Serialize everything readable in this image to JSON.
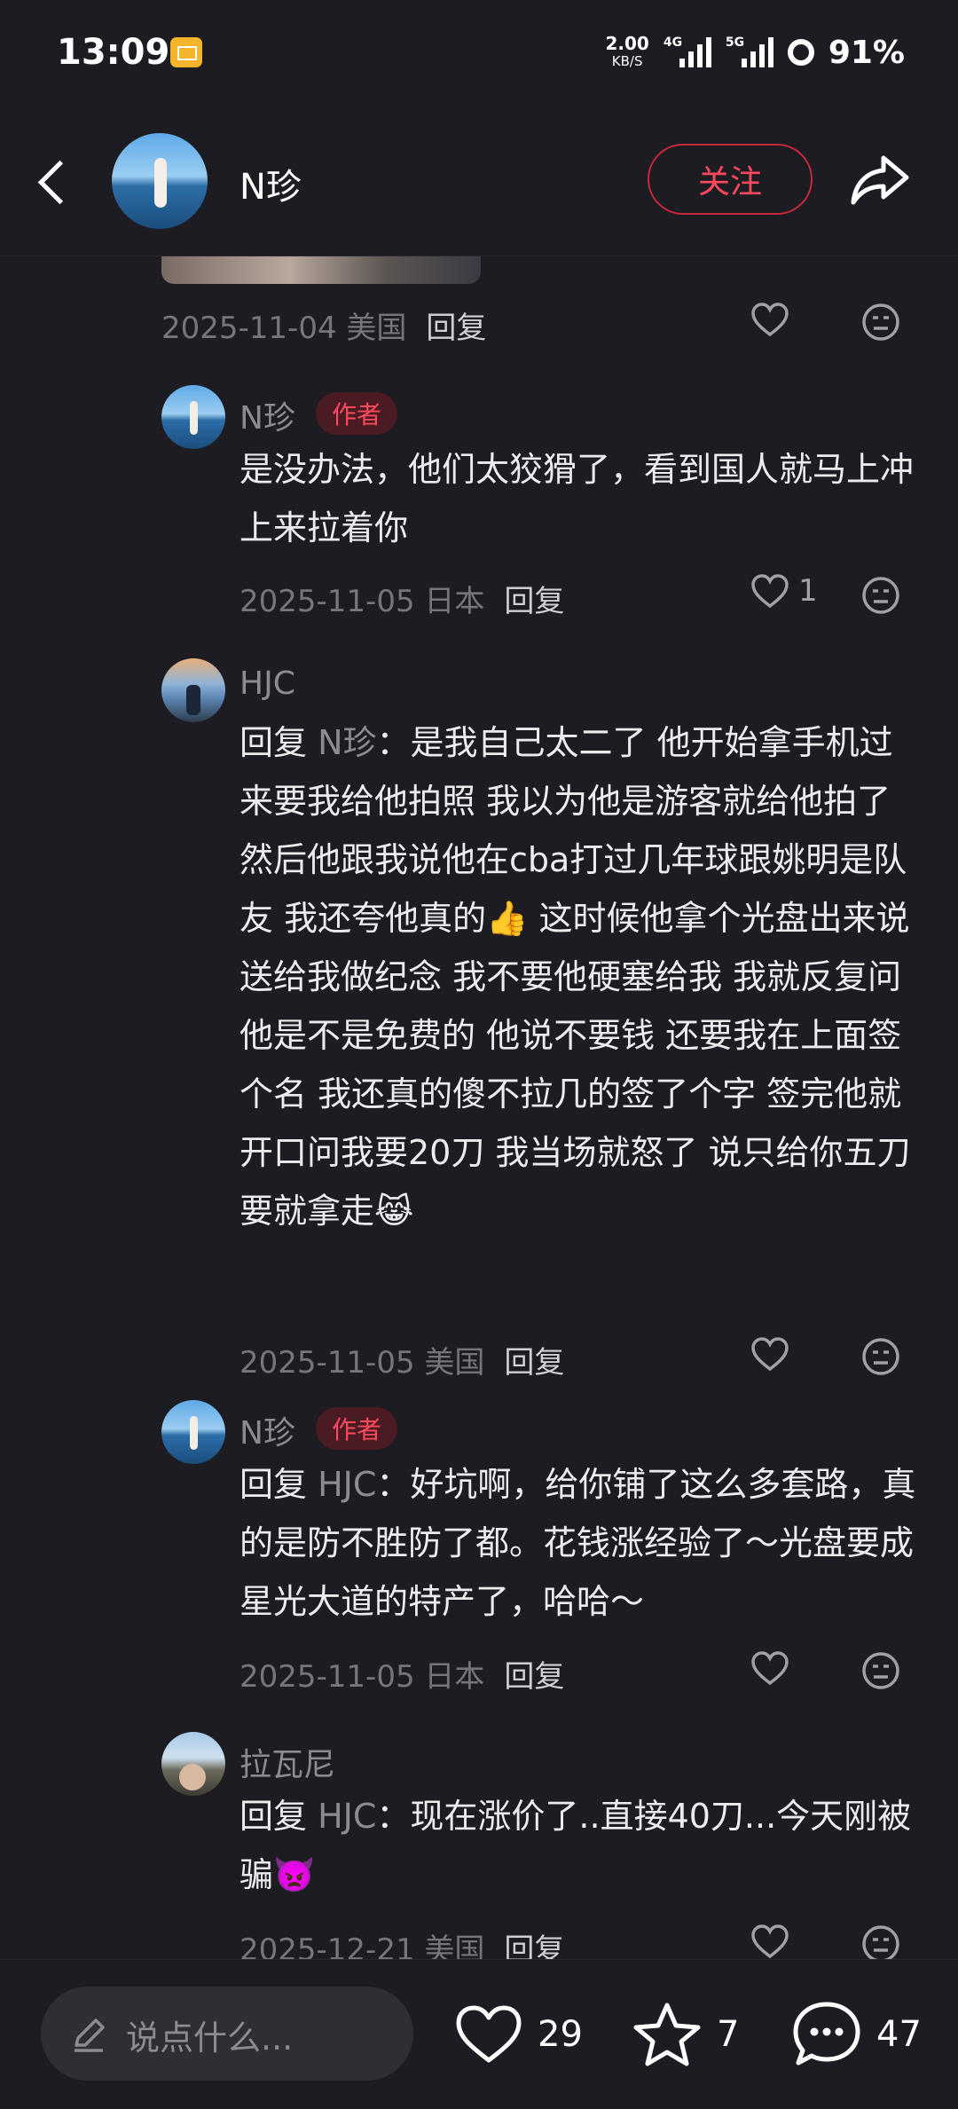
{
  "status_bar": {
    "time": "13:09",
    "net_speed": "2.00",
    "net_unit": "KB/S",
    "sig1_label": "4G",
    "sig2_label": "5G",
    "battery": "91%"
  },
  "header": {
    "name": "N珍",
    "follow_label": "关注"
  },
  "comments": [
    {
      "meta_date": "2025-11-04 美国",
      "reply_label": "回复",
      "like_count": ""
    },
    {
      "name": "N珍",
      "author_tag": "作者",
      "text": "是没办法，他们太狡猾了，看到国人就马上冲上来拉着你",
      "meta_date": "2025-11-05 日本",
      "reply_label": "回复",
      "like_count": "1"
    },
    {
      "name": "HJC",
      "reply_prefix": "回复 ",
      "reply_target": "N珍",
      "text": "：是我自己太二了 他开始拿手机过来要我给他拍照 我以为他是游客就给他拍了 然后他跟我说他在cba打过几年球跟姚明是队友 我还夸他真的👍 这时候他拿个光盘出来说送给我做纪念 我不要他硬塞给我 我就反复问他是不是免费的 他说不要钱 还要我在上面签个名 我还真的傻不拉几的签了个字 签完他就开口问我要20刀 我当场就怒了 说只给你五刀 要就拿走😹",
      "meta_date": "2025-11-05 美国",
      "reply_label": "回复"
    },
    {
      "name": "N珍",
      "author_tag": "作者",
      "reply_prefix": "回复 ",
      "reply_target": "HJC",
      "text": "：好坑啊，给你铺了这么多套路，真的是防不胜防了都。花钱涨经验了～光盘要成星光大道的特产了，哈哈～",
      "meta_date": "2025-11-05 日本",
      "reply_label": "回复"
    },
    {
      "name": "拉瓦尼",
      "reply_prefix": "回复 ",
      "reply_target": "HJC",
      "text": "：现在涨价了..直接40刀...今天刚被骗👿",
      "meta_date": "2025-12-21 美国",
      "reply_label": "回复"
    }
  ],
  "bottom_bar": {
    "input_placeholder": "说点什么...",
    "like_count": "29",
    "star_count": "7",
    "comment_count": "47"
  },
  "colors": {
    "background": "#1c1c22",
    "accent_red": "#ff4a5e",
    "muted_text": "#8b8b93"
  },
  "icons": [
    "back-icon",
    "share-icon",
    "heart-icon",
    "dislike-face-icon",
    "pen-icon",
    "star-icon",
    "comment-bubble-icon"
  ]
}
